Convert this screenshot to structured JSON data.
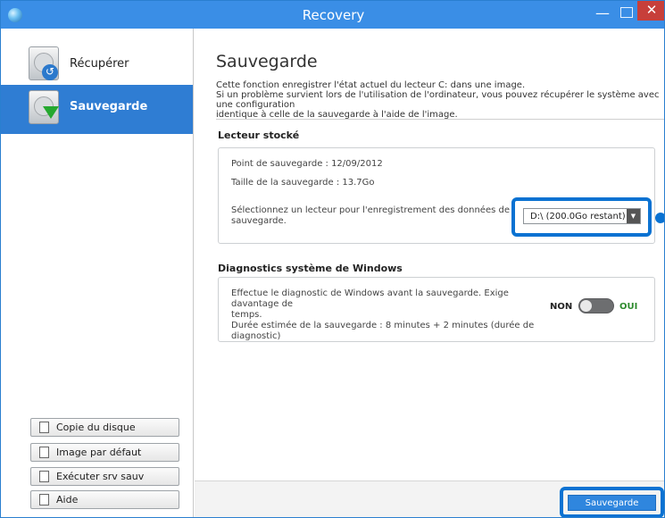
{
  "window": {
    "title": "Recovery",
    "min_glyph": "—",
    "close_glyph": "✕"
  },
  "sidebar": {
    "nav": [
      {
        "label": "Récupérer",
        "icon": "disk-restore-icon"
      },
      {
        "label": "Sauvegarde",
        "icon": "disk-backup-icon",
        "selected": true
      }
    ],
    "tools": [
      {
        "label": "Copie du disque",
        "icon": "copy-disk-icon"
      },
      {
        "label": "Image par défaut",
        "icon": "default-image-icon"
      },
      {
        "label": "Exécuter srv sauv",
        "icon": "run-service-icon"
      },
      {
        "label": "Aide",
        "icon": "help-icon"
      }
    ]
  },
  "main": {
    "title": "Sauvegarde",
    "description": [
      "Cette fonction enregistrer l'état actuel du lecteur C: dans une image.",
      "Si un problème survient lors de l'utilisation de l'ordinateur, vous pouvez récupérer le système avec une configuration",
      "identique à celle de la sauvegarde à l'aide de l'image."
    ],
    "storage": {
      "heading": "Lecteur stocké",
      "backup_point": "Point de sauvegarde : 12/09/2012",
      "backup_size": "Taille de la sauvegarde : 13.7Go",
      "select_prompt_line1": "Sélectionnez un lecteur pour l'enregistrement des données de",
      "select_prompt_line2": "sauvegarde.",
      "selected_drive": "D:\\ (200.0Go restant)"
    },
    "diagnostics": {
      "heading": "Diagnostics système de Windows",
      "line1": "Effectue le diagnostic de Windows avant la sauvegarde. Exige davantage de",
      "line2": "temps.",
      "line3": "Durée estimée de la sauvegarde : 8 minutes + 2 minutes (durée de diagnostic)",
      "toggle_off_label": "NON",
      "toggle_on_label": "OUI",
      "toggle_state": "NON"
    },
    "save_button": "Sauvegarde"
  },
  "colors": {
    "accent": "#2f7dd3",
    "highlight": "#0a72d2",
    "close": "#c73f3a",
    "yes": "#2e8b2e"
  }
}
